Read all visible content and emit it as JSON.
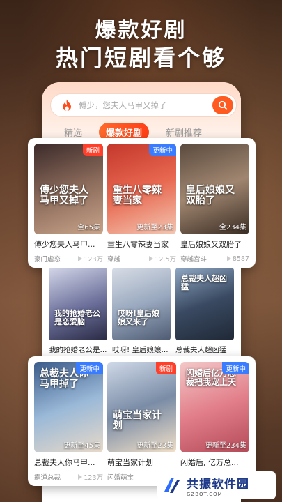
{
  "header": {
    "line1": "爆款好剧",
    "line2": "热门短剧看个够"
  },
  "search": {
    "placeholder": "傅少，您夫人马甲又掉了"
  },
  "tabs": [
    {
      "label": "精选",
      "active": false
    },
    {
      "label": "爆款好剧",
      "active": true
    },
    {
      "label": "新剧推荐",
      "active": false
    }
  ],
  "row1": [
    {
      "title": "傅少您夫人马甲...",
      "badge": "新剧",
      "badge_type": "new",
      "episodes": "全65集",
      "genre": "豪门虐恋",
      "views": "123万",
      "poster_text": "傅少您夫人马甲又掉了"
    },
    {
      "title": "重生八零辣妻当家",
      "badge": "更新中",
      "badge_type": "upd",
      "episodes": "更新至23集",
      "genre": "穿越",
      "views": "12.5万",
      "poster_text": "重生八零辣妻当家"
    },
    {
      "title": "皇后娘娘又双胎了",
      "badge": "",
      "badge_type": "",
      "episodes": "全234集",
      "genre": "穿越宫斗",
      "views": "8587",
      "poster_text": "皇后娘娘又双胎了"
    }
  ],
  "row2": [
    {
      "title": "我的抢婚老公是...",
      "poster_text": "我的抢婚老公是恋爱脑"
    },
    {
      "title": "哎呀! 皇后娘娘...",
      "poster_text": "哎呀!皇后娘娘又来了"
    },
    {
      "title": "总裁夫人超凶猛",
      "poster_text": "总裁夫人超凶猛"
    }
  ],
  "row3": [
    {
      "title": "总裁夫人你马甲...",
      "badge": "更新中",
      "badge_type": "upd",
      "episodes": "更新至45集",
      "genre": "霸道总裁",
      "views": "123万",
      "poster_text": "总裁夫人你马甲掉了"
    },
    {
      "title": "萌宝当家计划",
      "badge": "新剧",
      "badge_type": "new",
      "episodes": "更新至23集",
      "genre": "闪婚萌宝",
      "views": "",
      "poster_text": "萌宝当家计划"
    },
    {
      "title": "闪婚后, 亿万总...",
      "badge": "更新中",
      "badge_type": "upd",
      "episodes": "更新至234集",
      "genre": "",
      "views": "",
      "poster_text": "闪婚后亿万总裁把我宠上天"
    }
  ],
  "watermark": {
    "name": "共振软件园",
    "url": "GZBQT.COM"
  },
  "colors": {
    "accent": "#ff5a1f",
    "badge_new": "#ff3f2a",
    "badge_update": "#3a7cff"
  }
}
